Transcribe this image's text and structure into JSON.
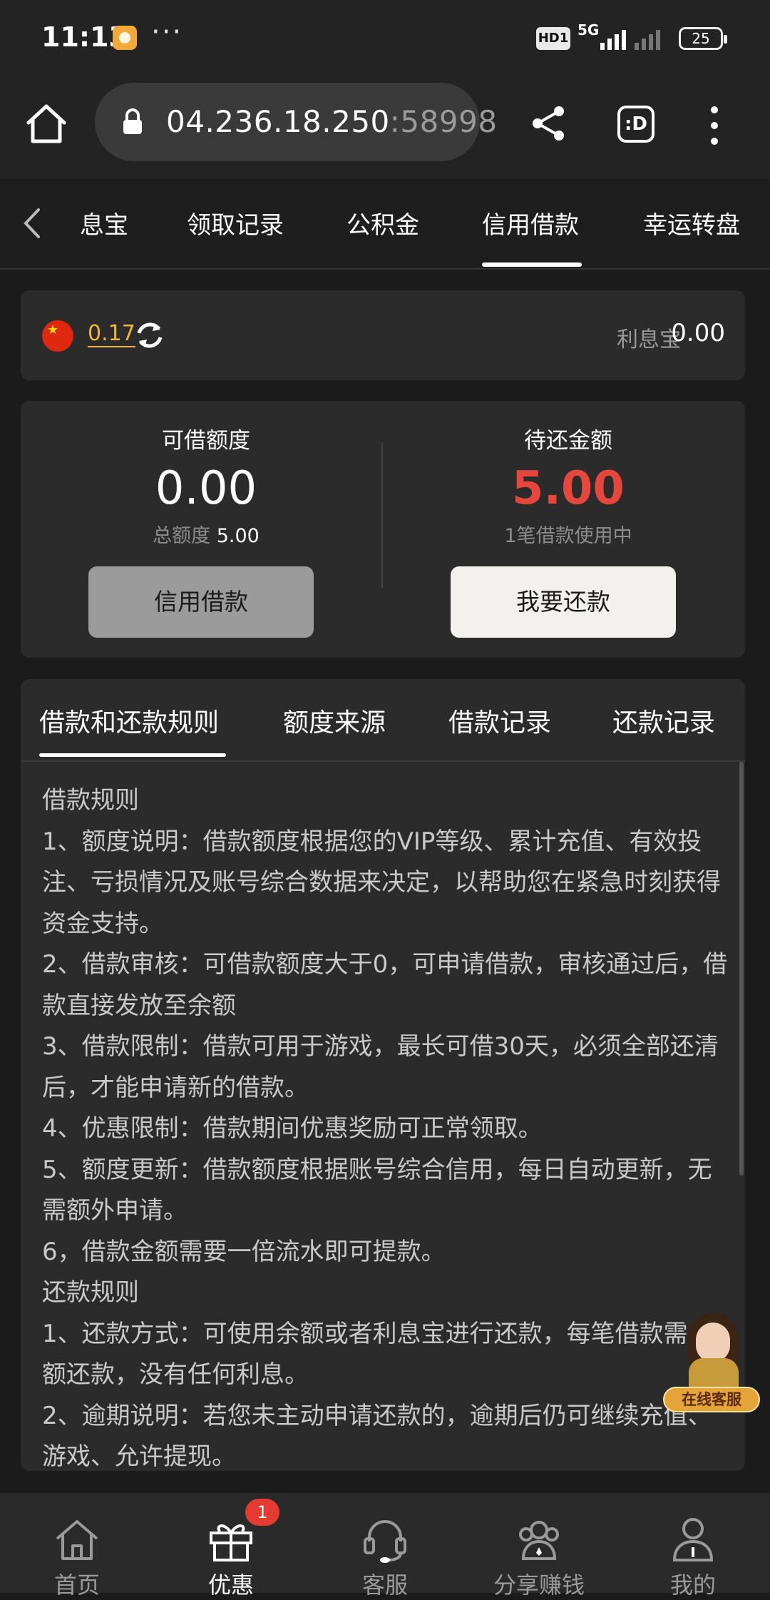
{
  "status_bar": {
    "time": "11:13",
    "more_indicator": "···",
    "hd_badge": "HD1",
    "network": "5G",
    "battery": "25"
  },
  "browser": {
    "url_host": "04.236.18.250",
    "url_port": ":58998",
    "tab_icon_label": ":D"
  },
  "category_tabs": {
    "items": [
      "息宝",
      "领取记录",
      "公积金",
      "信用借款",
      "幸运转盘"
    ],
    "active_index": 3
  },
  "balance": {
    "value": "0.17",
    "lixibao_label": "利息宝",
    "lixibao_value": "0.00"
  },
  "loan": {
    "available_label": "可借额度",
    "available_value": "0.00",
    "total_label": "总额度",
    "total_value": "5.00",
    "borrow_button": "信用借款",
    "due_label": "待还金额",
    "due_value": "5.00",
    "due_note": "1笔借款使用中",
    "repay_button": "我要还款"
  },
  "rules_tabs": {
    "items": [
      "借款和还款规则",
      "额度来源",
      "借款记录",
      "还款记录"
    ],
    "active_index": 0
  },
  "rules_text": [
    "借款规则",
    "1、额度说明：借款额度根据您的VIP等级、累计充值、有效投注、亏损情况及账号综合数据来决定，以帮助您在紧急时刻获得资金支持。",
    "2、借款审核：可借款额度大于0，可申请借款，审核通过后，借款直接发放至余额",
    "3、借款限制：借款可用于游戏，最长可借30天，必须全部还清后，才能申请新的借款。",
    "4、优惠限制：借款期间优惠奖励可正常领取。",
    "5、额度更新：借款额度根据账号综合信用，每日自动更新，无需额外申请。",
    "6，借款金额需要一倍流水即可提款。",
    "还款规则",
    "1、还款方式：可使用余额或者利息宝进行还款，每笔借款需全额还款，没有任何利息。",
    "2、逾期说明：若您未主动申请还款的，逾期后仍可继续充值、游戏、允许提现。"
  ],
  "float_service": {
    "label": "在线客服"
  },
  "bottom_nav": {
    "items": [
      {
        "label": "首页",
        "icon": "home-icon"
      },
      {
        "label": "优惠",
        "icon": "gift-icon",
        "badge": "1"
      },
      {
        "label": "客服",
        "icon": "headset-icon"
      },
      {
        "label": "分享赚钱",
        "icon": "share-people-icon"
      },
      {
        "label": "我的",
        "icon": "user-icon"
      }
    ],
    "active_index": 1
  },
  "colors": {
    "background": "#1b1b1b",
    "card": "#2b2b2b",
    "accent_gold": "#f2b53a",
    "due_red": "#e5473d",
    "badge_red": "#e53a2f"
  }
}
